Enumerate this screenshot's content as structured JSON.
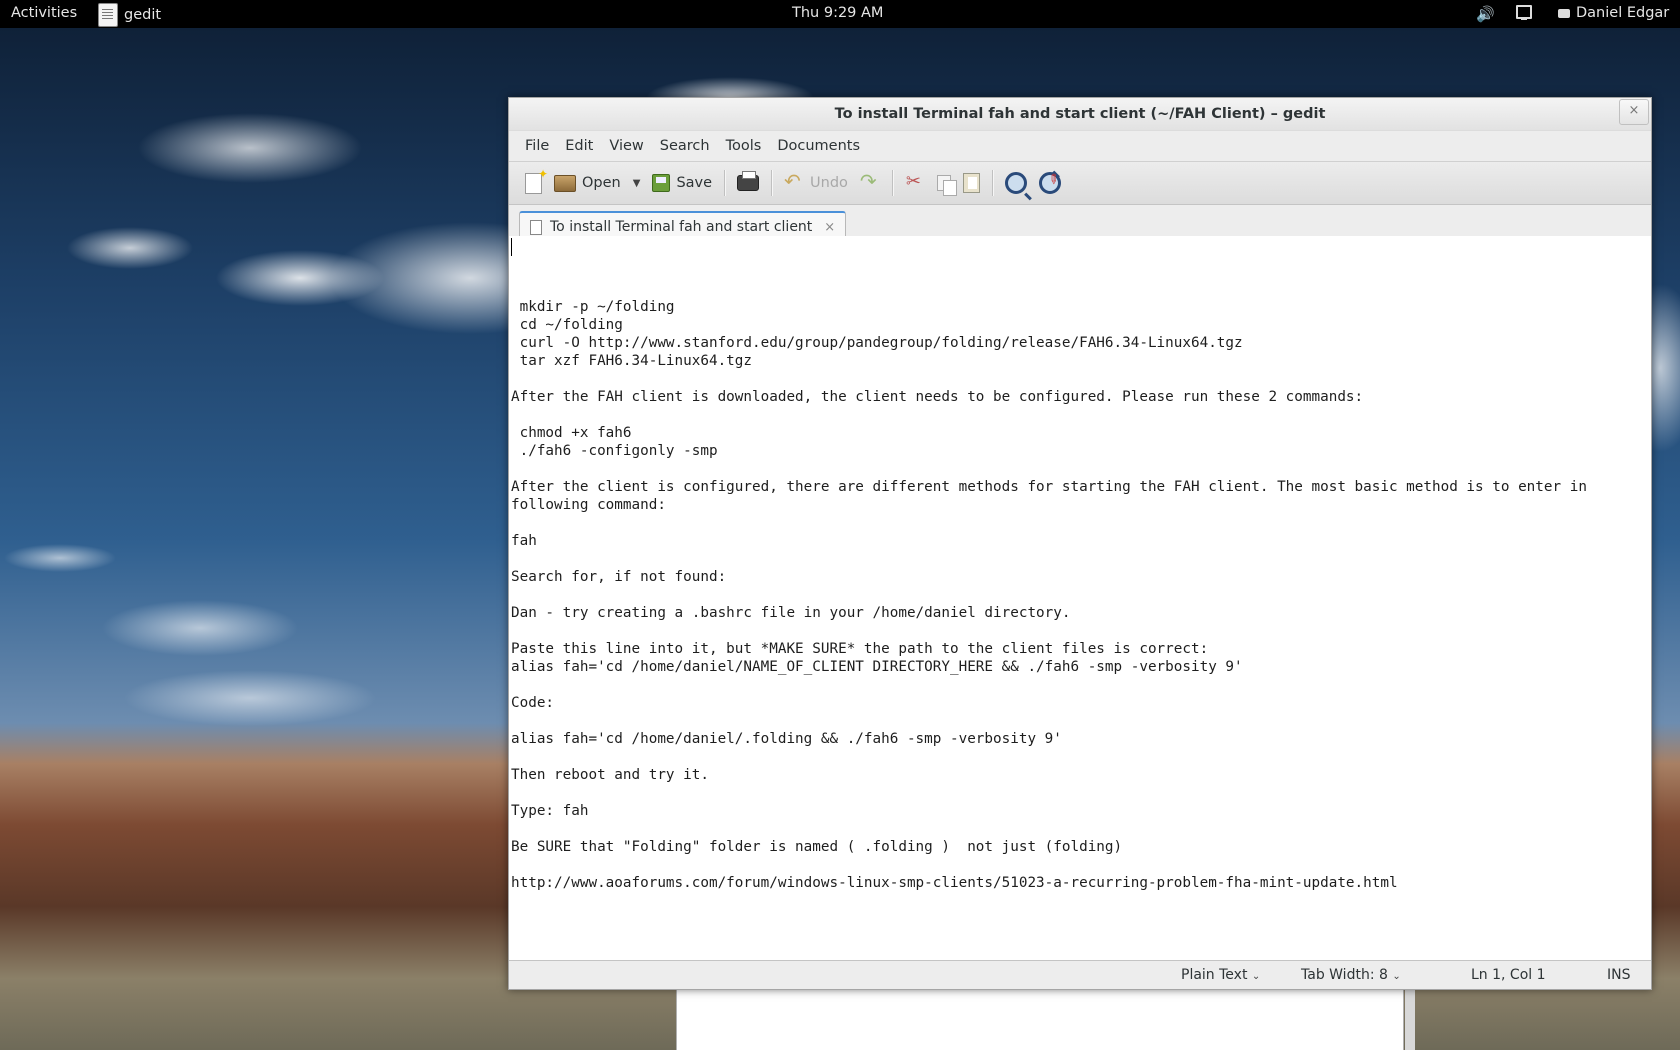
{
  "topbar": {
    "activities": "Activities",
    "app_name": "gedit",
    "clock": "Thu  9:29 AM",
    "user": "Daniel Edgar"
  },
  "window": {
    "title": "To install Terminal fah and start client (~/FAH Client) – gedit",
    "close": "×"
  },
  "menu": [
    "File",
    "Edit",
    "View",
    "Search",
    "Tools",
    "Documents"
  ],
  "toolbar": {
    "open_label": "Open",
    "save_label": "Save",
    "undo_label": "Undo"
  },
  "tab": {
    "label": "To install Terminal fah and start client",
    "close": "×"
  },
  "document": {
    "lines": [
      " mkdir -p ~/folding",
      " cd ~/folding",
      " curl -O http://www.stanford.edu/group/pandegroup/folding/release/FAH6.34-Linux64.tgz",
      " tar xzf FAH6.34-Linux64.tgz",
      "",
      "After the FAH client is downloaded, the client needs to be configured. Please run these 2 commands:",
      "",
      " chmod +x fah6",
      " ./fah6 -configonly -smp",
      "",
      "After the client is configured, there are different methods for starting the FAH client. The most basic method is to enter in",
      "following command:",
      "",
      "fah",
      "",
      "Search for, if not found:",
      "",
      "Dan - try creating a .bashrc file in your /home/daniel directory.",
      "",
      "Paste this line into it, but *MAKE SURE* the path to the client files is correct:",
      "alias fah='cd /home/daniel/NAME_OF_CLIENT DIRECTORY_HERE && ./fah6 -smp -verbosity 9'",
      "",
      "Code:",
      "",
      "alias fah='cd /home/daniel/.folding && ./fah6 -smp -verbosity 9'",
      "",
      "Then reboot and try it.",
      "",
      "Type: fah",
      "",
      "Be SURE that \"Folding\" folder is named ( .folding )  not just (folding)",
      "",
      "http://www.aoaforums.com/forum/windows-linux-smp-clients/51023-a-recurring-problem-fha-mint-update.html"
    ]
  },
  "statusbar": {
    "language": "Plain Text",
    "tab_width": "Tab Width:  8",
    "position": "Ln 1, Col 1",
    "mode": "INS"
  },
  "icons": {
    "volume": "speaker-icon",
    "network": "network-icon",
    "user": "message-icon"
  }
}
